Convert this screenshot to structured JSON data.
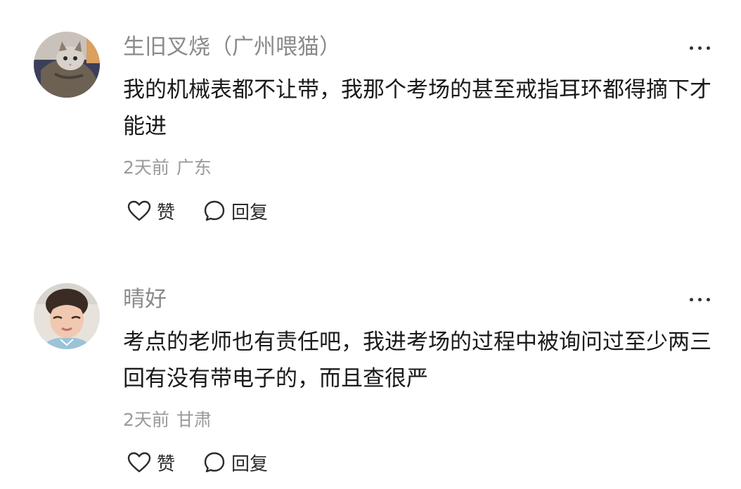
{
  "comments": [
    {
      "username": "生旧叉烧（广州喂猫）",
      "text": "我的机械表都不让带，我那个考场的甚至戒指耳环都得摘下才能进",
      "time": "2天前",
      "location": "广东",
      "like_label": "赞",
      "reply_label": "回复",
      "avatar": "cat-avatar"
    },
    {
      "username": "晴好",
      "text": "考点的老师也有责任吧，我进考场的过程中被询问过至少两三回有没有带电子的，而且查很严",
      "time": "2天前",
      "location": "甘肃",
      "like_label": "赞",
      "reply_label": "回复",
      "avatar": "child-avatar"
    }
  ],
  "icons": {
    "like": "heart-outline-icon",
    "reply": "speech-bubble-icon",
    "more": "ellipsis-icon"
  },
  "colors": {
    "username": "#8a8a8a",
    "text": "#1a1a1a",
    "meta": "#9a9a9a"
  }
}
